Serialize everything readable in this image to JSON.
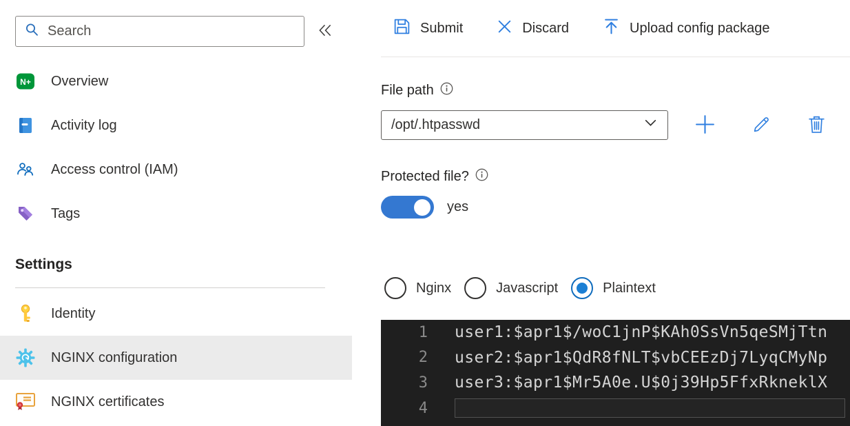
{
  "sidebar": {
    "search_placeholder": "Search",
    "collapse_icon": "double-chevron-left-icon",
    "items": [
      {
        "label": "Overview",
        "icon": "nginx-logo-icon",
        "selected": false
      },
      {
        "label": "Activity log",
        "icon": "activity-log-icon",
        "selected": false
      },
      {
        "label": "Access control (IAM)",
        "icon": "access-control-icon",
        "selected": false
      },
      {
        "label": "Tags",
        "icon": "tags-icon",
        "selected": false
      }
    ],
    "settings_header": "Settings",
    "settings_items": [
      {
        "label": "Identity",
        "icon": "key-icon",
        "selected": false
      },
      {
        "label": "NGINX configuration",
        "icon": "gear-icon",
        "selected": true
      },
      {
        "label": "NGINX certificates",
        "icon": "certificate-icon",
        "selected": false
      }
    ]
  },
  "toolbar": {
    "items": [
      {
        "label": "Submit",
        "icon": "save-icon"
      },
      {
        "label": "Discard",
        "icon": "close-icon"
      },
      {
        "label": "Upload config package",
        "icon": "upload-icon"
      }
    ]
  },
  "form": {
    "file_path": {
      "label": "File path",
      "value": "/opt/.htpasswd"
    },
    "protected": {
      "label": "Protected file?",
      "value": "yes",
      "state": "on"
    },
    "radios": [
      {
        "label": "Nginx",
        "selected": false
      },
      {
        "label": "Javascript",
        "selected": false
      },
      {
        "label": "Plaintext",
        "selected": true
      }
    ]
  },
  "editor": {
    "lines": [
      {
        "number": "1",
        "text": "user1:$apr1$/woC1jnP$KAh0SsVn5qeSMjTtn",
        "current": false
      },
      {
        "number": "2",
        "text": "user2:$apr1$QdR8fNLT$vbCEEzDj7LyqCMyNp",
        "current": false
      },
      {
        "number": "3",
        "text": "user3:$apr1$Mr5A0e.U$0j39Hp5FfxRkneklX",
        "current": false
      },
      {
        "number": "4",
        "text": "",
        "current": true
      }
    ]
  },
  "colors": {
    "accent": "#0078d4",
    "action_icon_blue": "#2f7fe0",
    "toggle_on": "#3478d1",
    "selected_row_bg": "#ebebeb",
    "editor_bg": "#1f1f1f",
    "editor_text": "#d4d4d4",
    "editor_line_number": "#8a8a8a",
    "nginx_green": "#009639",
    "tag_purple": "#8661c5",
    "key_yellow": "#ffc83d",
    "gear_blue": "#4dc2ea",
    "cert_orange": "#e8a33d",
    "ribbon_red": "#d13438"
  }
}
